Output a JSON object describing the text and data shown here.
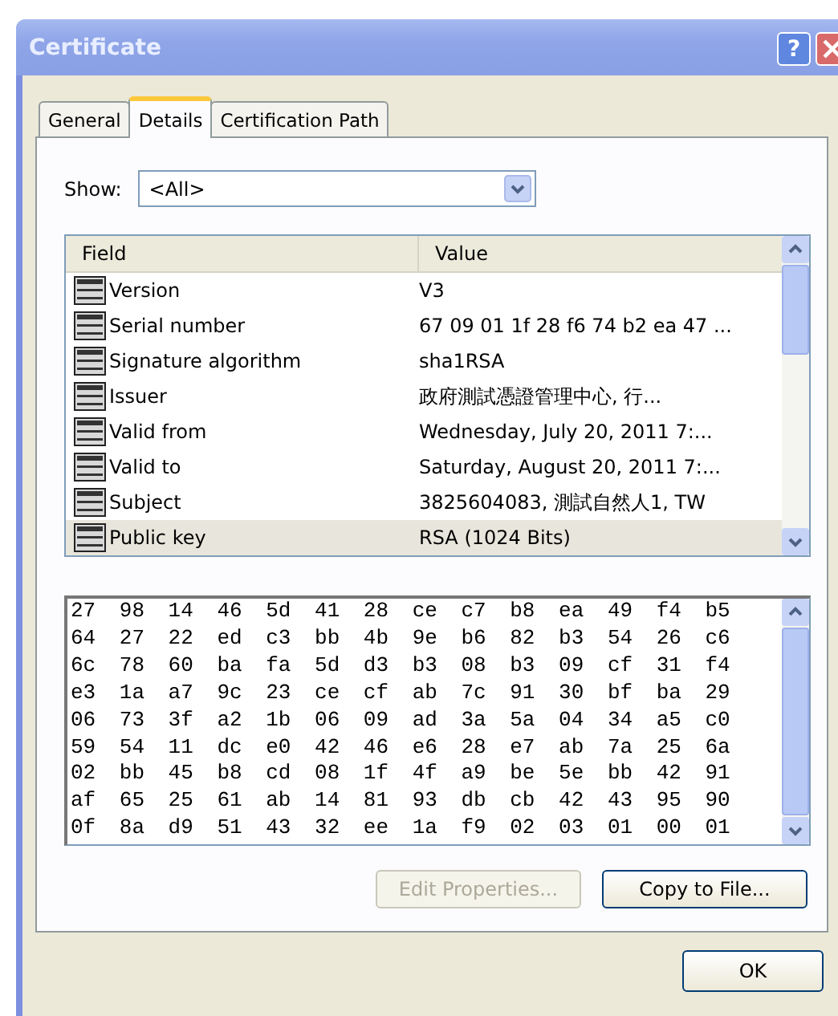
{
  "window": {
    "title": "Certificate",
    "title_buttons": [
      {
        "kind": "help",
        "label": "?"
      },
      {
        "kind": "close"
      }
    ]
  },
  "tabs": [
    {
      "label": "General",
      "selected": false
    },
    {
      "label": "Details",
      "selected": true
    },
    {
      "label": "Certification Path",
      "selected": false
    }
  ],
  "show": {
    "label": "Show:",
    "value": "<All>"
  },
  "table": {
    "columns": [
      "Field",
      "Value"
    ],
    "rows": [
      {
        "field": "Version",
        "value": "V3",
        "selected": false
      },
      {
        "field": "Serial number",
        "value": "67 09 01 1f 28 f6 74 b2 ea 47 ...",
        "selected": false
      },
      {
        "field": "Signature algorithm",
        "value": "sha1RSA",
        "selected": false
      },
      {
        "field": "Issuer",
        "value": "政府測試憑證管理中心, 行...",
        "selected": false
      },
      {
        "field": "Valid from",
        "value": "Wednesday, July 20, 2011 7:...",
        "selected": false
      },
      {
        "field": "Valid to",
        "value": "Saturday, August 20, 2011 7:...",
        "selected": false
      },
      {
        "field": "Subject",
        "value": "3825604083, 測試自然人1, TW",
        "selected": false
      },
      {
        "field": "Public key",
        "value": "RSA (1024 Bits)",
        "selected": true
      }
    ]
  },
  "detail_lines": [
    "27 98 14 46 5d 41 28 ce c7 b8 ea 49 f4 b5",
    "64 27 22 ed c3 bb 4b 9e b6 82 b3 54 26 c6",
    "6c 78 60 ba fa 5d d3 b3 08 b3 09 cf 31 f4",
    "e3 1a a7 9c 23 ce cf ab 7c 91 30 bf ba 29",
    "06 73 3f a2 1b 06 09 ad 3a 5a 04 34 a5 c0",
    "59 54 11 dc e0 42 46 e6 28 e7 ab 7a 25 6a",
    "02 bb 45 b8 cd 08 1f 4f a9 be 5e bb 42 91",
    "af 65 25 61 ab 14 81 93 db cb 42 43 95 90",
    "0f 8a d9 51 43 32 ee 1a f9 02 03 01 00 01"
  ],
  "buttons": [
    {
      "label": "Edit Properties...",
      "disabled": true
    },
    {
      "label": "Copy to File...",
      "disabled": false
    }
  ],
  "footer_buttons": [
    {
      "label": "OK",
      "disabled": false
    }
  ]
}
